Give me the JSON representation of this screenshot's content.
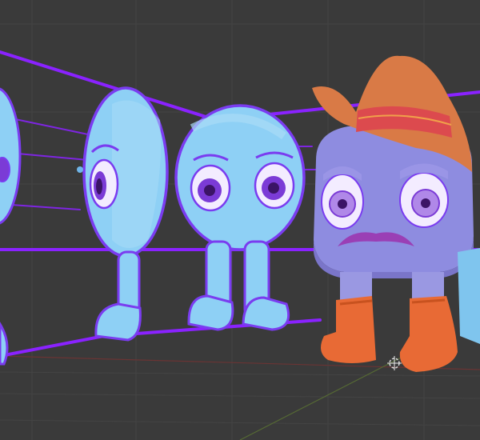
{
  "viewport": {
    "background": "#3a3a3a",
    "grid_color": "#434343",
    "axis_red": "#7a3a3a",
    "axis_green": "#5c6e3a"
  },
  "colors": {
    "guide_line": "#8a22ff",
    "sketch_stroke": "#7a3cf0",
    "sketch_fill": "#8ed0f5",
    "sketch_fill_shade": "#6fb5e8",
    "eye_white": "#f3ecff",
    "iris": "#7b3bd6",
    "pupil": "#3b1466",
    "mascot_body": "#8e8ce0",
    "mascot_body_shade": "#7a75c9",
    "legs": "#9a98e2",
    "hat": "#d97a46",
    "hat_band": "#dc4a4e",
    "hat_band_highlight": "#f0a04a",
    "boots": "#e86a35",
    "mustache": "#9a3fb5"
  },
  "objects": [
    {
      "name": "sketch-character-far-left",
      "kind": "sketch"
    },
    {
      "name": "sketch-character-side-view",
      "kind": "sketch"
    },
    {
      "name": "sketch-character-front-view",
      "kind": "sketch"
    },
    {
      "name": "cowboy-mascot",
      "kind": "3d-model"
    },
    {
      "name": "3d-cursor-icon",
      "kind": "gizmo"
    }
  ]
}
